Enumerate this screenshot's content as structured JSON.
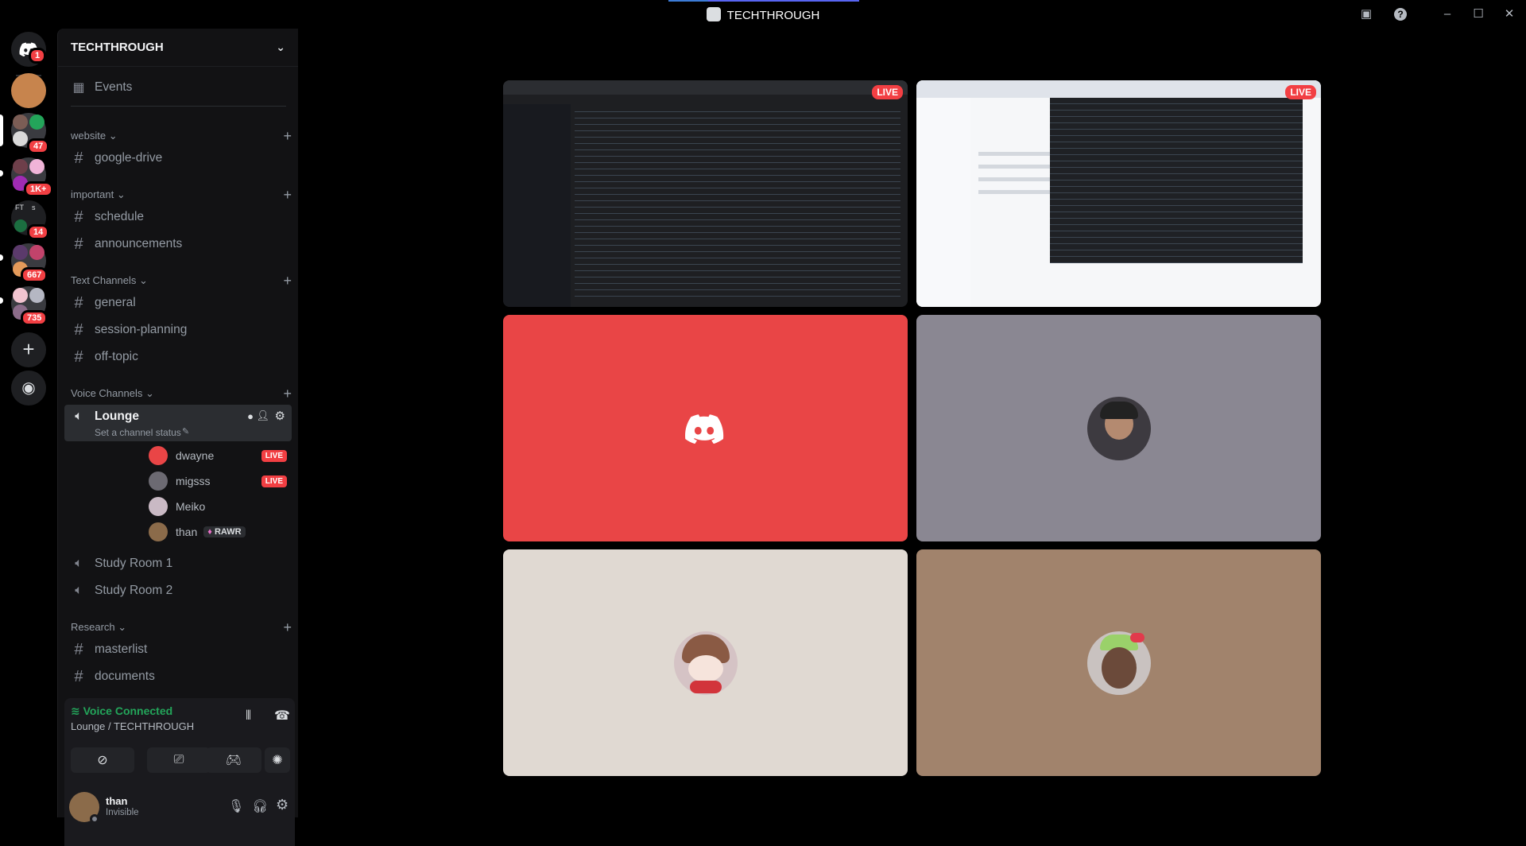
{
  "window": {
    "title": "TECHTHROUGH"
  },
  "rail": {
    "home_badge": "1",
    "servers": [
      {
        "name": "server-1",
        "badge": ""
      },
      {
        "name": "server-2",
        "badge": "47"
      },
      {
        "name": "server-3",
        "badge": "1K+"
      },
      {
        "name": "server-4",
        "badge": "14"
      },
      {
        "name": "server-5",
        "badge": "667"
      },
      {
        "name": "server-6",
        "badge": "735"
      }
    ],
    "ft_label": "FT"
  },
  "guild": {
    "name": "TECHTHROUGH"
  },
  "events_label": "Events",
  "categories": {
    "website": "website",
    "important": "important",
    "text": "Text Channels",
    "voice": "Voice Channels",
    "research": "Research"
  },
  "channels": {
    "google_drive": "google-drive",
    "schedule": "schedule",
    "announcements": "announcements",
    "general": "general",
    "session_planning": "session-planning",
    "off_topic": "off-topic",
    "lounge": "Lounge",
    "lounge_status": "Set a channel status",
    "study1": "Study Room 1",
    "study2": "Study Room 2",
    "masterlist": "masterlist",
    "documents": "documents"
  },
  "voice_members": [
    {
      "name": "dwayne",
      "tag": "LIVE"
    },
    {
      "name": "migsss",
      "tag": "LIVE"
    },
    {
      "name": "Meiko",
      "tag": ""
    },
    {
      "name": "than",
      "tag": "RAWR"
    }
  ],
  "voice_panel": {
    "status": "Voice Connected",
    "location": "Lounge / TECHTHROUGH"
  },
  "user": {
    "name": "than",
    "status": "Invisible"
  },
  "stage": {
    "live_label": "LIVE"
  },
  "colors": {
    "accent": "#5865f2",
    "live": "#f23f43",
    "connected": "#23a55a",
    "tile_red": "#e94546",
    "tile_grey": "#8a8792",
    "tile_cream": "#e0d9d2",
    "tile_brown": "#a1836c"
  }
}
